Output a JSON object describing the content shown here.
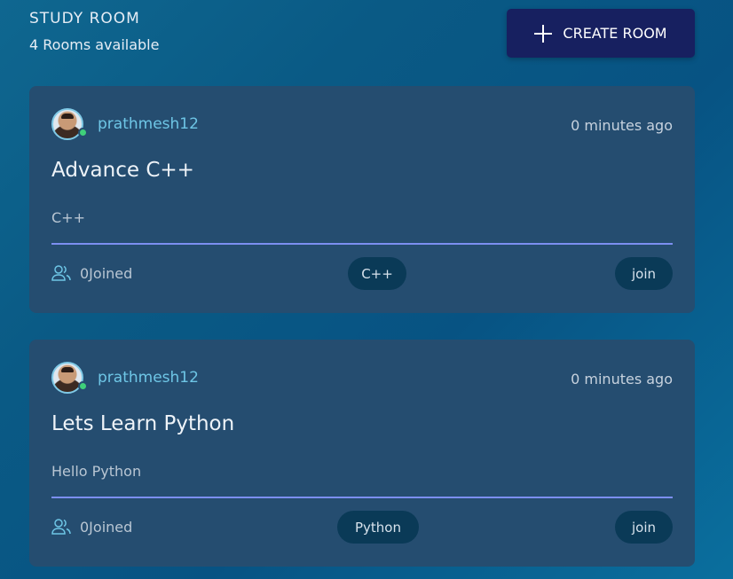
{
  "header": {
    "title": "STUDY ROOM",
    "subtitle": "4 Rooms available"
  },
  "create_button": {
    "label": "CREATE ROOM",
    "icon": "plus-icon"
  },
  "rooms": [
    {
      "username": "prathmesh12",
      "timestamp": "0 minutes ago",
      "title": "Advance C++",
      "description": "C++",
      "joined": "0Joined",
      "tag": "C++",
      "join_label": "join",
      "online": true
    },
    {
      "username": "prathmesh12",
      "timestamp": "0 minutes ago",
      "title": "Lets Learn Python",
      "description": "Hello Python",
      "joined": "0Joined",
      "tag": "Python",
      "join_label": "join",
      "online": true
    }
  ],
  "colors": {
    "card_bg": "#254d70",
    "button_bg": "#172060",
    "username": "#6ec6e6",
    "divider": "#7c8ff0",
    "online": "#3fd07a",
    "pill_bg": "#0a3a57"
  }
}
